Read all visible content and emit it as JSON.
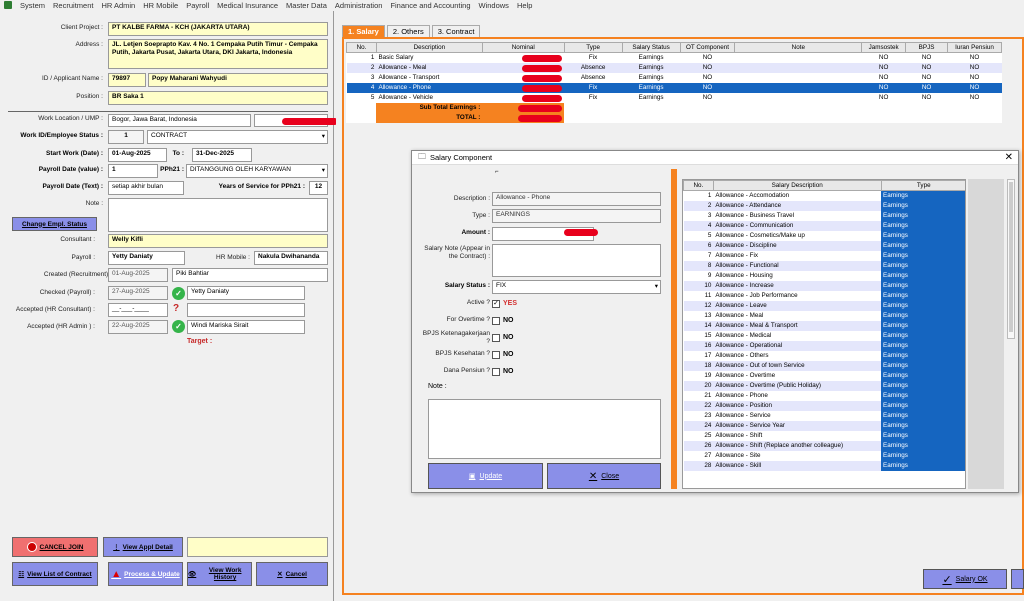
{
  "menu": [
    "System",
    "Recruitment",
    "HR Admin",
    "HR Mobile",
    "Payroll",
    "Medical Insurance",
    "Master Data",
    "Administration",
    "Finance and Accounting",
    "Windows",
    "Help"
  ],
  "form": {
    "client_project_label": "Client Project :",
    "client_project": "PT KALBE FARMA - KCH (JAKARTA UTARA)",
    "address_label": "Address :",
    "address": "JL. Letjen Soeprapto Kav. 4 No. 1 Cempaka Putih Timur - Cempaka Putih, Jakarta Pusat, Jakarta Utara, DKI Jakarta, Indonesia",
    "id_label": "ID / Applicant Name :",
    "id": "79897",
    "name": "Popy Maharani Wahyudi",
    "position_label": "Position :",
    "position": "BR Saka 1",
    "work_location_label": "Work Location / UMP :",
    "work_location": "Bogor, Jawa Barat, Indonesia",
    "work_status_label": "Work ID/Employee Status :",
    "work_id": "1",
    "work_status": "CONTRACT",
    "start_work_label": "Start Work (Date) :",
    "start_date": "01-Aug-2025",
    "to_label": "To :",
    "end_date": "31-Dec-2025",
    "payroll_value_label": "Payroll Date (value) :",
    "payroll_value": "1",
    "pph21_label": "PPh21 :",
    "pph21": "DITANGGUNG OLEH KARYAWAN",
    "payroll_text_label": "Payroll Date (Text) :",
    "payroll_text": "setiap akhir bulan",
    "years_label": "Years of Service for PPh21 :",
    "years": "12",
    "note_label": "Note :",
    "change_status": "Change Empl. Status",
    "consultant_label": "Consultant :",
    "consultant": "Welly Kifli",
    "payroll_label": "Payroll :",
    "payroll": "Yetty Daniaty",
    "hr_mobile_label": "HR Mobile :",
    "hr_mobile": "Nakula Dwihananda",
    "created_label": "Created (Recruitment):",
    "created_date": "01-Aug-2025",
    "created_by": "Piki Bahtiar",
    "checked_label": "Checked (Payroll) :",
    "checked_date": "27-Aug-2025",
    "checked_by": "Yetty Daniaty",
    "accepted_hrc_label": "Accepted (HR Consultant) :",
    "accepted_hrc_date": "__-___-____",
    "accepted_hra_label": "Accepted (HR Admin ) :",
    "accepted_hra_date": "22-Aug-2025",
    "accepted_hra_by": "Windi Mariska Sirait",
    "target_label": "Target :"
  },
  "left_buttons": {
    "cancel_join": "CANCEL JOIN",
    "view_appl": "View Appl Detail",
    "view_list": "View List of Contract",
    "process": "Process & Update",
    "view_work": "View Work History",
    "cancel": "Cancel"
  },
  "tabs": [
    "1. Salary",
    "2. Others",
    "3. Contract"
  ],
  "salary_table": {
    "headers": [
      "No.",
      "Description",
      "Nominal",
      "Type",
      "Salary Status",
      "OT Component",
      "Note",
      "Jamsostek",
      "BPJS",
      "Iuran Pensiun"
    ],
    "rows": [
      {
        "no": "1",
        "desc": "Basic Salary",
        "type": "Fix",
        "status": "Earnings",
        "ot": "NO",
        "jam": "NO",
        "bpjs": "NO",
        "iuran": "NO"
      },
      {
        "no": "2",
        "desc": "Allowance - Meal",
        "type": "Absence",
        "status": "Earnings",
        "ot": "NO",
        "jam": "NO",
        "bpjs": "NO",
        "iuran": "NO"
      },
      {
        "no": "3",
        "desc": "Allowance - Transport",
        "type": "Absence",
        "status": "Earnings",
        "ot": "NO",
        "jam": "NO",
        "bpjs": "NO",
        "iuran": "NO"
      },
      {
        "no": "4",
        "desc": "Allowance - Phone",
        "type": "Fix",
        "status": "Earnings",
        "ot": "NO",
        "jam": "NO",
        "bpjs": "NO",
        "iuran": "NO"
      },
      {
        "no": "5",
        "desc": "Allowance - Vehicle",
        "type": "Fix",
        "status": "Earnings",
        "ot": "NO",
        "jam": "NO",
        "bpjs": "NO",
        "iuran": "NO"
      }
    ],
    "subtotal_label": "Sub Total Earnings :",
    "total_label": "TOTAL :"
  },
  "dialog": {
    "title": "Salary Component",
    "description_label": "Description :",
    "description": "Allowance - Phone",
    "type_label": "Type :",
    "type": "EARNINGS",
    "amount_label": "Amount :",
    "salary_note_label": "Salary Note (Appear in the Contract) :",
    "salary_status_label": "Salary Status :",
    "salary_status": "FIX",
    "active_label": "Active ?",
    "active": "YES",
    "overtime_label": "For Overtime ?",
    "overtime": "NO",
    "bpjs_tk_label": "BPJS Ketenagakerjaan ?",
    "bpjs_tk": "NO",
    "bpjs_kes_label": "BPJS Kesehatan ?",
    "bpjs_kes": "NO",
    "pensiun_label": "Dana Pensiun ?",
    "pensiun": "NO",
    "note_label": "Note :",
    "update": "Update",
    "close": "Close",
    "list_headers": [
      "No.",
      "Salary Description",
      "Type"
    ],
    "list": [
      [
        "1",
        "Allowance - Accomodation",
        "Earnings"
      ],
      [
        "2",
        "Allowance - Attendance",
        "Earnings"
      ],
      [
        "3",
        "Allowance - Business Travel",
        "Earnings"
      ],
      [
        "4",
        "Allowance - Communication",
        "Earnings"
      ],
      [
        "5",
        "Allowance - Cosmetics/Make up",
        "Earnings"
      ],
      [
        "6",
        "Allowance - Discipline",
        "Earnings"
      ],
      [
        "7",
        "Allowance - Fix",
        "Earnings"
      ],
      [
        "8",
        "Allowance - Functional",
        "Earnings"
      ],
      [
        "9",
        "Allowance - Housing",
        "Earnings"
      ],
      [
        "10",
        "Allowance - Increase",
        "Earnings"
      ],
      [
        "11",
        "Allowance - Job Performance",
        "Earnings"
      ],
      [
        "12",
        "Allowance - Leave",
        "Earnings"
      ],
      [
        "13",
        "Allowance - Meal",
        "Earnings"
      ],
      [
        "14",
        "Allowance - Meal & Transport",
        "Earnings"
      ],
      [
        "15",
        "Allowance - Medical",
        "Earnings"
      ],
      [
        "16",
        "Allowance - Operational",
        "Earnings"
      ],
      [
        "17",
        "Allowance - Others",
        "Earnings"
      ],
      [
        "18",
        "Allowance - Out of town Service",
        "Earnings"
      ],
      [
        "19",
        "Allowance - Overtime",
        "Earnings"
      ],
      [
        "20",
        "Allowance - Overtime (Public Holiday)",
        "Earnings"
      ],
      [
        "21",
        "Allowance - Phone",
        "Earnings"
      ],
      [
        "22",
        "Allowance - Position",
        "Earnings"
      ],
      [
        "23",
        "Allowance - Service",
        "Earnings"
      ],
      [
        "24",
        "Allowance - Service Year",
        "Earnings"
      ],
      [
        "25",
        "Allowance - Shift",
        "Earnings"
      ],
      [
        "26",
        "Allowance - Shift (Replace another colleague)",
        "Earnings"
      ],
      [
        "27",
        "Allowance - Site",
        "Earnings"
      ],
      [
        "28",
        "Allowance - Skill",
        "Earnings"
      ]
    ]
  },
  "salary_ok": "Salary OK"
}
